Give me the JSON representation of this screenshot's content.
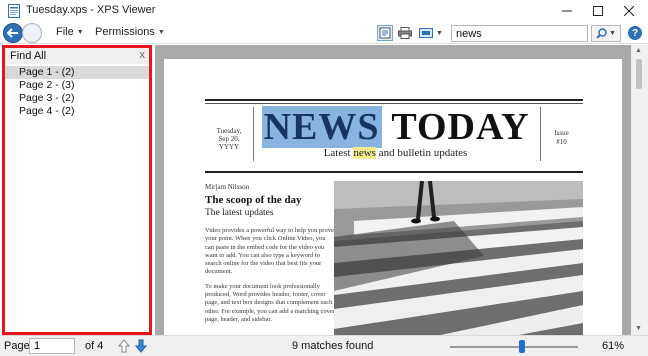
{
  "window": {
    "title": "Tuesday.xps - XPS Viewer"
  },
  "toolbar": {
    "menus": [
      {
        "label": "File"
      },
      {
        "label": "Permissions"
      }
    ],
    "search": {
      "value": "news"
    }
  },
  "find_panel": {
    "title": "Find All",
    "close_label": "x",
    "results": [
      {
        "label": "Page 1 - (2)",
        "selected": true
      },
      {
        "label": "Page 2 - (3)",
        "selected": false
      },
      {
        "label": "Page 3 - (2)",
        "selected": false
      },
      {
        "label": "Page 4 - (2)",
        "selected": false
      }
    ]
  },
  "document": {
    "masthead_date": [
      "Tuesday,",
      "Sep 20,",
      "YYYY"
    ],
    "masthead_title_highlight": "NEWS",
    "masthead_title_rest": "TODAY",
    "subtitle_before": "Latest ",
    "subtitle_highlight": "news",
    "subtitle_after": " and bulletin updates",
    "issue": [
      "Issue",
      "#10"
    ],
    "author": "Mirjam Nilsson",
    "headline": "The scoop of the day",
    "subheadline": "The latest updates",
    "paragraphs": [
      "Video provides a powerful way to help you prove your point. When you click Online Video, you can paste in the embed code for the video you want to add. You can also type a keyword to search online for the video that best fits your document.",
      "To make your document look professionally produced, Word provides header, footer, cover page, and text box designs that complement each other. For example, you can add a matching cover page, header, and sidebar."
    ]
  },
  "status": {
    "page_label": "Page",
    "page_value": "1",
    "of_label": "of 4",
    "matches": "9 matches found",
    "zoom_percent": 61,
    "zoom_label": "61%"
  },
  "colors": {
    "accent": "#2f6fb5",
    "panel_border": "#e8161c",
    "highlight_blue": "#8ab4e0",
    "highlight_yellow": "#f6ec8e"
  }
}
